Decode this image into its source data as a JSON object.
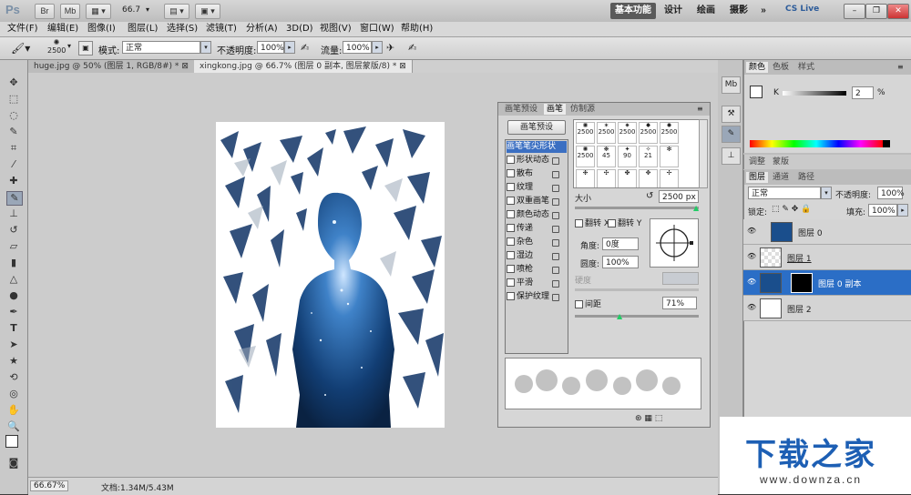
{
  "appbar": {
    "logo": "Ps",
    "buttons": [
      "Br",
      "Mb"
    ],
    "zoom": "66.7",
    "workspaces": [
      "基本功能",
      "设计",
      "绘画",
      "摄影"
    ],
    "more": "»",
    "cslive": "CS Live"
  },
  "menu": [
    "文件(F)",
    "编辑(E)",
    "图像(I)",
    "图层(L)",
    "选择(S)",
    "滤镜(T)",
    "分析(A)",
    "3D(D)",
    "视图(V)",
    "窗口(W)",
    "帮助(H)"
  ],
  "options": {
    "brush_size": "2500",
    "mode_label": "模式:",
    "mode_value": "正常",
    "opacity_label": "不透明度:",
    "opacity_value": "100%",
    "flow_label": "流量:",
    "flow_value": "100%"
  },
  "tabs": [
    {
      "label": "huge.jpg @ 50% (图层 1, RGB/8#) *"
    },
    {
      "label": "xingkong.jpg @ 66.7% (图层 0 副本, 图层蒙版/8) *"
    }
  ],
  "status": {
    "zoom": "66.67%",
    "doc": "文档:1.34M/5.43M"
  },
  "brush_panel": {
    "tabs": [
      "画笔预设",
      "画笔",
      "仿制源"
    ],
    "preset_button": "画笔预设",
    "items": [
      {
        "label": "画笔笔尖形状",
        "selected": true
      },
      {
        "label": "形状动态"
      },
      {
        "label": "散布"
      },
      {
        "label": "纹理"
      },
      {
        "label": "双重画笔"
      },
      {
        "label": "颜色动态"
      },
      {
        "label": "传递"
      },
      {
        "label": "杂色"
      },
      {
        "label": "湿边"
      },
      {
        "label": "喷枪"
      },
      {
        "label": "平滑"
      },
      {
        "label": "保护纹理"
      }
    ],
    "tip_sizes_row1": [
      "2500",
      "2500",
      "2500",
      "2500",
      "2500"
    ],
    "tip_sizes_row2": [
      "2500",
      "45",
      "90",
      "21"
    ],
    "size_label": "大小",
    "size_value": "2500 px",
    "flip_x": "翻转 X",
    "flip_y": "翻转 Y",
    "angle_label": "角度:",
    "angle_value": "0度",
    "roundness_label": "圆度:",
    "roundness_value": "100%",
    "hardness_label": "硬度",
    "spacing_label": "间距",
    "spacing_value": "71%"
  },
  "color_panel": {
    "tabs": [
      "颜色",
      "色板",
      "样式"
    ],
    "k_label": "K",
    "k_value": "2",
    "unit": "%"
  },
  "adj_panel": {
    "tabs": [
      "调整",
      "蒙版"
    ]
  },
  "layers_panel": {
    "tabs": [
      "图层",
      "通道",
      "路径"
    ],
    "blend_mode": "正常",
    "opacity_label": "不透明度:",
    "opacity_value": "100%",
    "lock_label": "锁定:",
    "fill_label": "填充:",
    "fill_value": "100%",
    "layers": [
      {
        "name": "图层 0"
      },
      {
        "name": "图层 1"
      },
      {
        "name": "图层 0 副本"
      },
      {
        "name": "图层 2"
      }
    ]
  },
  "watermark": {
    "title": "下载之家",
    "url": "www.downza.cn"
  },
  "colors": {
    "accent": "#2b6ec6",
    "galaxy": "#1a4e8c"
  }
}
